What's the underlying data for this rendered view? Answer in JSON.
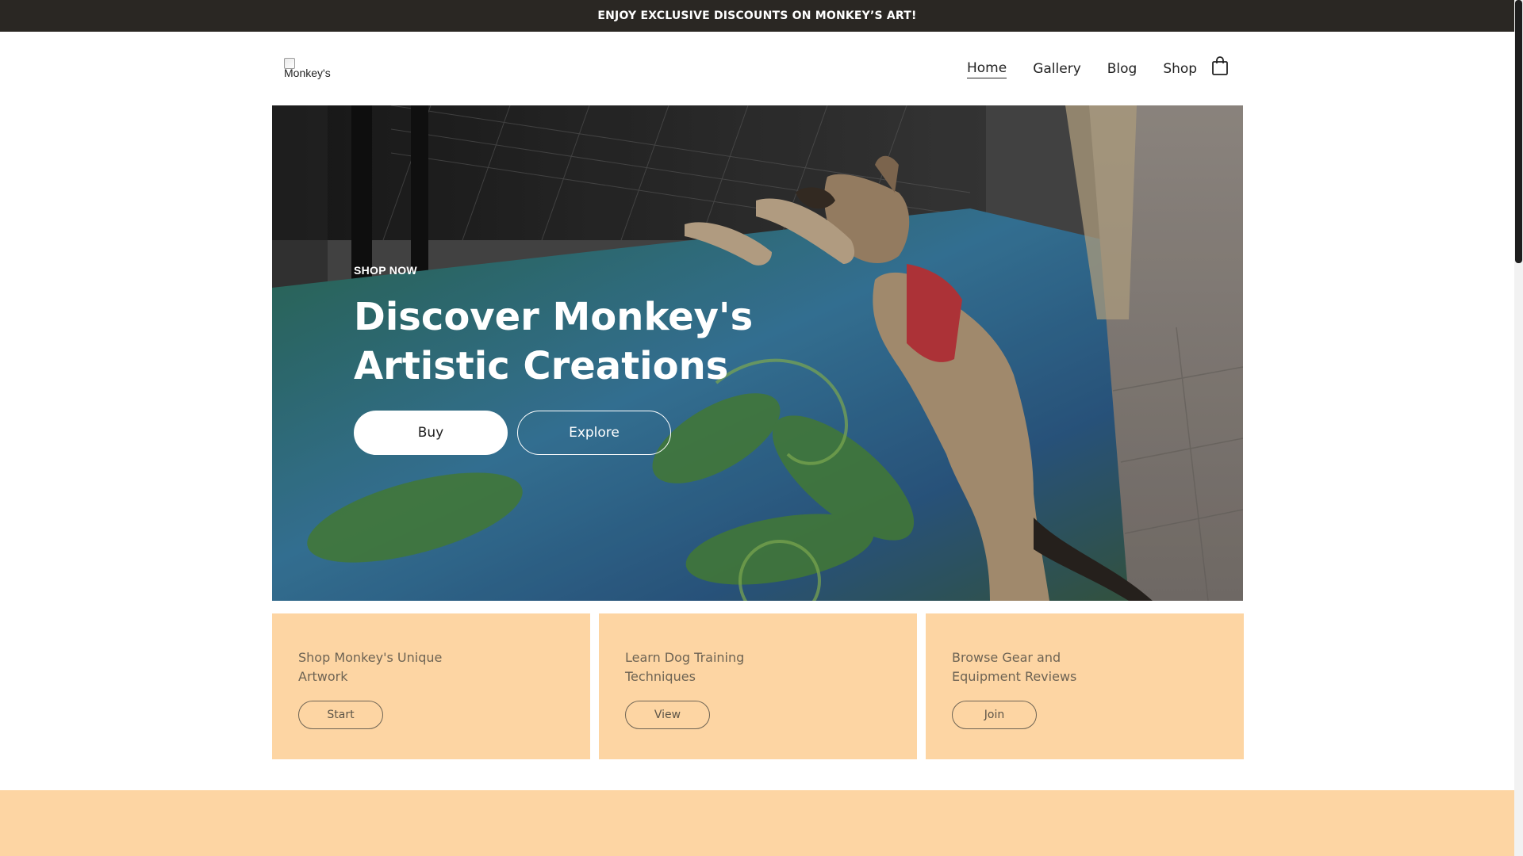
{
  "announcement": "ENJOY EXCLUSIVE DISCOUNTS ON MONKEY’S ART!",
  "header": {
    "logo_alt": "Monkey's",
    "nav": [
      {
        "label": "Home",
        "active": true
      },
      {
        "label": "Gallery",
        "active": false
      },
      {
        "label": "Blog",
        "active": false
      },
      {
        "label": "Shop",
        "active": false
      }
    ],
    "cart_icon": "shopping-bag-icon"
  },
  "hero": {
    "eyebrow": "SHOP NOW",
    "title_line1": "Discover Monkey's",
    "title_line2": "Artistic Creations",
    "buttons": {
      "buy": "Buy",
      "explore": "Explore"
    }
  },
  "cards": [
    {
      "line1": "Shop Monkey's Unique",
      "line2": "Artwork",
      "button": "Start"
    },
    {
      "line1": "Learn Dog Training",
      "line2": "Techniques",
      "button": "View"
    },
    {
      "line1": "Browse Gear and",
      "line2": "Equipment Reviews",
      "button": "Join"
    }
  ],
  "colors": {
    "announcement_bg": "#2a2723",
    "card_bg": "#fdd5a3",
    "card_text": "#6e6454"
  }
}
